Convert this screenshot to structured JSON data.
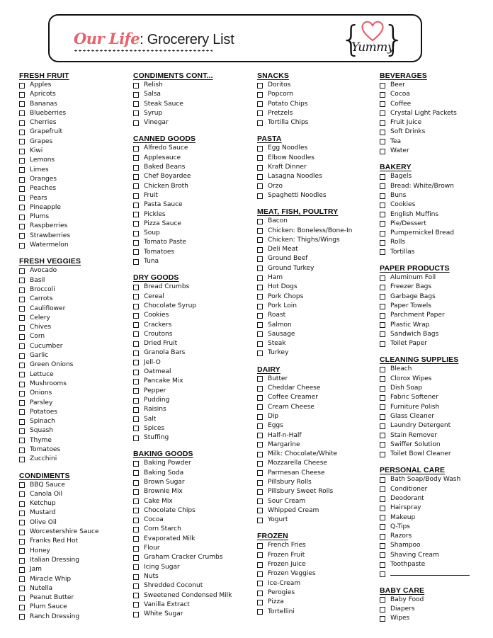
{
  "header": {
    "title_script": "Our Life",
    "title_rest": ": Grocerery List",
    "badge_word": "Yummy",
    "badge_brace_left": "{",
    "badge_brace_right": "}",
    "accent_color": "#e8616b",
    "heart_color": "#e8616b"
  },
  "columns": [
    {
      "sections": [
        {
          "title": "FRESH FRUIT",
          "items": [
            "Apples",
            "Apricots",
            "Bananas",
            "Blueberries",
            "Cherries",
            "Grapefruit",
            "Grapes",
            "Kiwi",
            "Lemons",
            "Limes",
            "Oranges",
            "Peaches",
            "Pears",
            "Pineapple",
            "Plums",
            "Raspberries",
            "Strawberries",
            "Watermelon"
          ]
        },
        {
          "title": "FRESH VEGGIES",
          "items": [
            "Avocado",
            "Basil",
            "Broccoli",
            "Carrots",
            "Cauliflower",
            "Celery",
            "Chives",
            "Corn",
            "Cucumber",
            "Garlic",
            "Green Onions",
            "Lettuce",
            "Mushrooms",
            "Onions",
            "Parsley",
            "Potatoes",
            "Spinach",
            "Squash",
            "Thyme",
            "Tomatoes",
            "Zucchini"
          ]
        },
        {
          "title": "CONDIMENTS",
          "items": [
            "BBQ  Sauce",
            "Canola Oil",
            "Ketchup",
            "Mustard",
            "Olive Oil",
            "Worcestershire Sauce",
            "Franks Red Hot",
            "Honey",
            "Italian Dressing",
            "Jam",
            "Miracle Whip",
            "Nutella",
            "Peanut Butter",
            "Plum Sauce",
            "Ranch Dressing"
          ]
        }
      ]
    },
    {
      "sections": [
        {
          "title": "CONDIMENTS CONT...",
          "items": [
            "Relish",
            "Salsa",
            "Steak Sauce",
            "Syrup",
            "Vinegar"
          ]
        },
        {
          "title": "CANNED GOODS",
          "items": [
            "Alfredo Sauce",
            "Applesauce",
            "Baked Beans",
            "Chef Boyardee",
            "Chicken Broth",
            "Fruit",
            "Pasta Sauce",
            "Pickles",
            "Pizza Sauce",
            "Soup",
            "Tomato Paste",
            "Tomatoes",
            "Tuna"
          ]
        },
        {
          "title": "DRY GOODS",
          "items": [
            "Bread Crumbs",
            "Cereal",
            "Chocolate Syrup",
            "Cookies",
            "Crackers",
            "Croutons",
            "Dried Fruit",
            "Granola Bars",
            "Jell-O",
            "Oatmeal",
            "Pancake Mix",
            "Pepper",
            "Pudding",
            "Raisins",
            "Salt",
            "Spices",
            "Stuffing"
          ]
        },
        {
          "title": "BAKING GOODS",
          "items": [
            "Baking Powder",
            "Baking Soda",
            "Brown Sugar",
            "Brownie Mix",
            "Cake Mix",
            "Chocolate Chips",
            "Cocoa",
            "Corn Starch",
            "Evaporated Milk",
            "Flour",
            "Graham Cracker Crumbs",
            "Icing Sugar",
            "Nuts",
            "Shredded Coconut",
            "Sweetened Condensed Milk",
            "Vanilla Extract",
            "White Sugar"
          ]
        }
      ]
    },
    {
      "sections": [
        {
          "title": "SNACKS",
          "items": [
            "Doritos",
            "Popcorn",
            "Potato Chips",
            "Pretzels",
            "Tortilla Chips"
          ]
        },
        {
          "title": "PASTA",
          "items": [
            "Egg Noodles",
            "Elbow Noodles",
            "Kraft Dinner",
            "Lasagna Noodles",
            "Orzo",
            "Spaghetti Noodles"
          ]
        },
        {
          "title": "MEAT, FISH, POULTRY",
          "items": [
            "Bacon",
            "Chicken: Boneless/Bone-In",
            "Chicken: Thighs/Wings",
            "Deli Meat",
            "Ground Beef",
            "Ground Turkey",
            "Ham",
            "Hot Dogs",
            "Pork Chops",
            "Pork Loin",
            "Roast",
            "Salmon",
            "Sausage",
            "Steak",
            "Turkey"
          ]
        },
        {
          "title": "DAIRY",
          "items": [
            "Butter",
            "Cheddar Cheese",
            "Coffee Creamer",
            "Cream Cheese",
            "Dip",
            "Eggs",
            "Half-n-Half",
            "Margarine",
            "Milk: Chocolate/White",
            "Mozzarella Cheese",
            "Parmesan Cheese",
            "Pillsbury Rolls",
            "Pillsbury Sweet Rolls",
            "Sour Cream",
            "Whipped Cream",
            "Yogurt"
          ]
        },
        {
          "title": "FROZEN",
          "items": [
            "French Fries",
            "Frozen Fruit",
            "Frozen Juice",
            "Frozen Veggies",
            "Ice-Cream",
            "Perogies",
            "Pizza",
            "Tortellini"
          ]
        }
      ]
    },
    {
      "sections": [
        {
          "title": "BEVERAGES",
          "items": [
            "Beer",
            "Cocoa",
            "Coffee",
            "Crystal Light Packets",
            "Fruit Juice",
            "Soft Drinks",
            "Tea",
            "Water"
          ]
        },
        {
          "title": "BAKERY",
          "items": [
            "Bagels",
            "Bread: White/Brown",
            "Buns",
            "Cookies",
            "English Muffins",
            "Pie/Dessert",
            "Pumpernickel Bread",
            "Rolls",
            "Tortillas"
          ]
        },
        {
          "title": "PAPER PRODUCTS",
          "items": [
            "Aluminum Foil",
            "Freezer Bags",
            "Garbage Bags",
            "Paper Towels",
            "Parchment Paper",
            "Plastic Wrap",
            "Sandwich Bags",
            "Toilet Paper"
          ]
        },
        {
          "title": "CLEANING SUPPLIES",
          "items": [
            "Bleach",
            "Clorox Wipes",
            "Dish Soap",
            "Fabric Softener",
            "Furniture Polish",
            "Glass Cleaner",
            "Laundry Detergent",
            "Stain Remover",
            "Swiffer Solution",
            "Toilet Bowl Cleaner"
          ]
        },
        {
          "title": "PERSONAL CARE",
          "items": [
            "Bath Soap/Body Wash",
            "Conditioner",
            "Deodorant",
            "Hairspray",
            "Makeup",
            "Q-Tips",
            "Razors",
            "Shampoo",
            "Shaving Cream",
            "Toothpaste",
            ""
          ]
        },
        {
          "title": "BABY CARE",
          "items": [
            "Baby Food",
            "Diapers",
            "Wipes"
          ]
        }
      ]
    }
  ]
}
